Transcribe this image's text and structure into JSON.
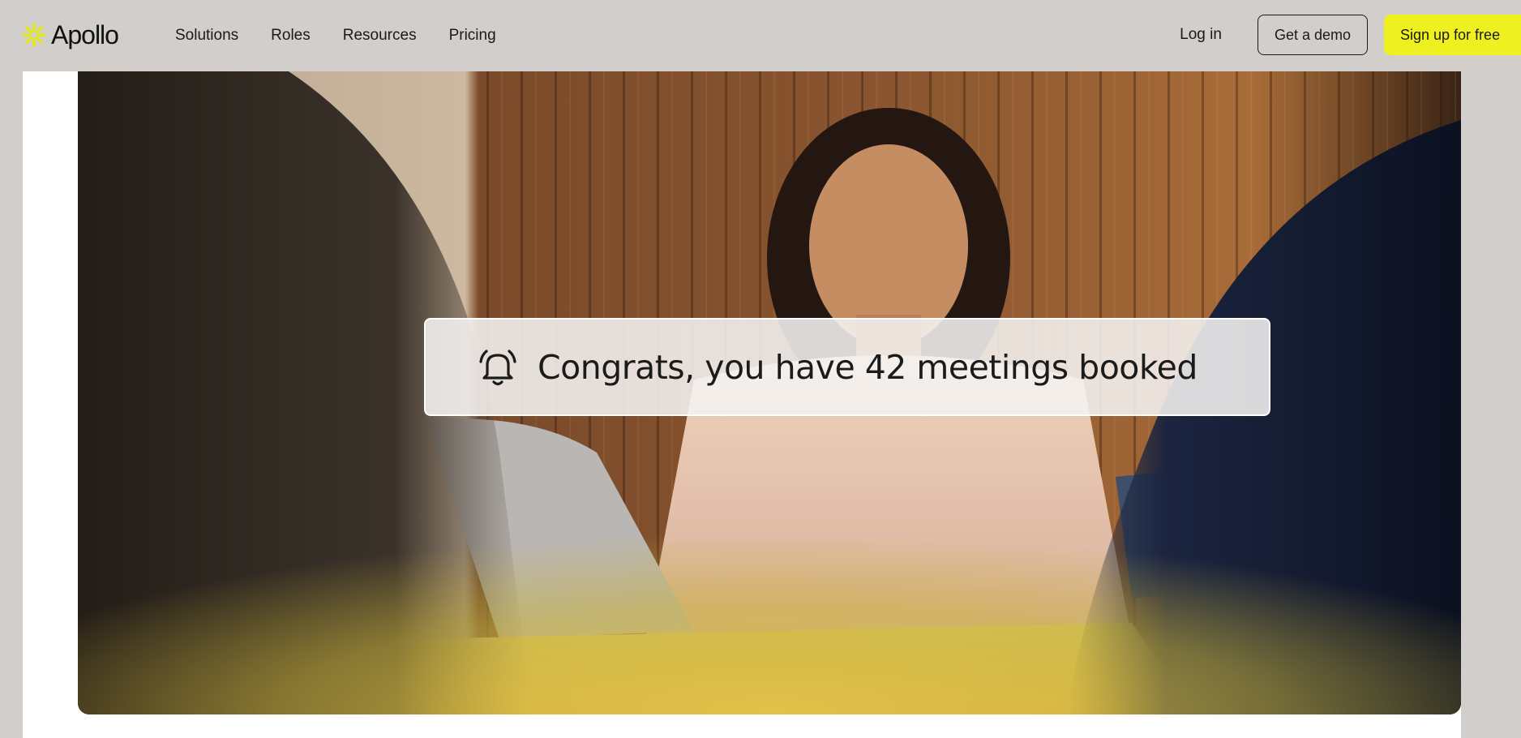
{
  "brand": {
    "name": "Apollo",
    "accent_color": "#eef11f",
    "logo_icon": "sunburst-logo-icon"
  },
  "nav": {
    "links": [
      {
        "label": "Solutions"
      },
      {
        "label": "Roles"
      },
      {
        "label": "Resources"
      },
      {
        "label": "Pricing"
      }
    ],
    "login_label": "Log in",
    "demo_label": "Get a demo",
    "signup_label": "Sign up for free"
  },
  "hero": {
    "notification": {
      "icon": "bell-icon",
      "text": "Congrats, you have 42 meetings booked"
    }
  },
  "colors": {
    "page_background": "#d1cecb",
    "card_background": "#ffffff",
    "notification_background": "#f5f3f1"
  }
}
